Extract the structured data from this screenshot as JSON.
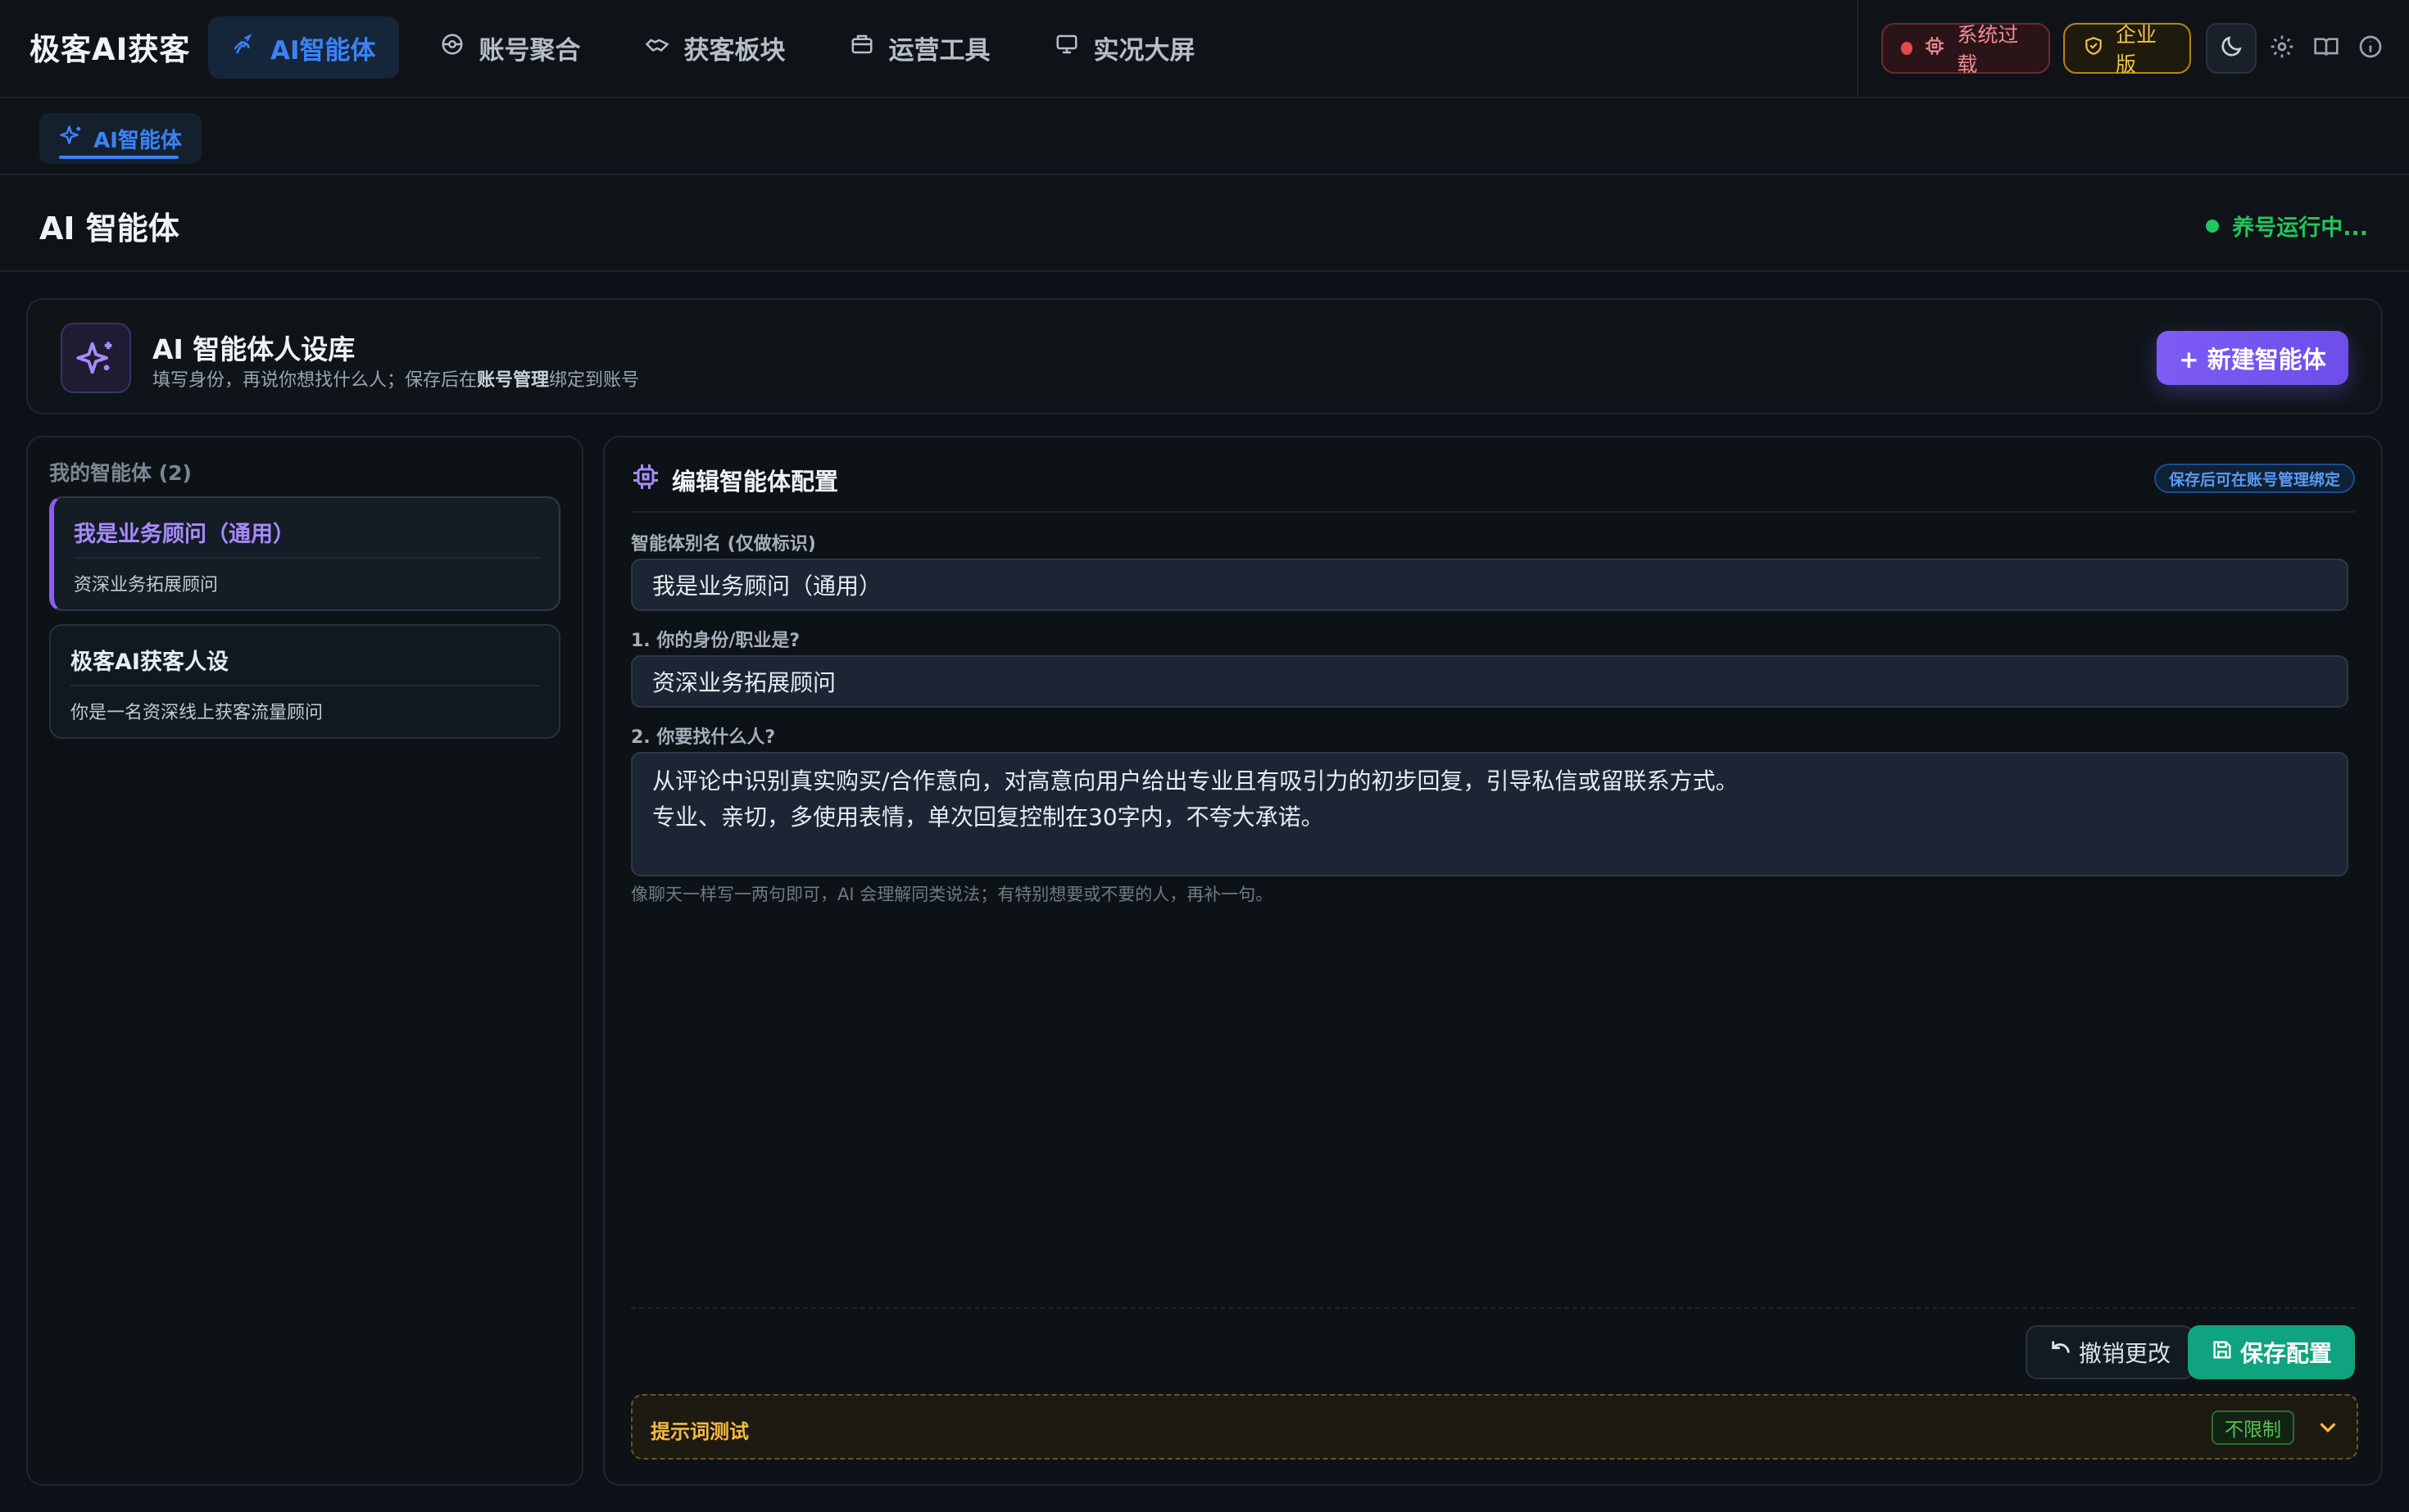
{
  "app": {
    "brand": "极客AI获客"
  },
  "nav": {
    "items": [
      {
        "label": "AI智能体",
        "icon": "satellite-icon",
        "active": true
      },
      {
        "label": "账号聚合",
        "icon": "network-icon"
      },
      {
        "label": "获客板块",
        "icon": "handshake-icon"
      },
      {
        "label": "运营工具",
        "icon": "briefcase-icon"
      },
      {
        "label": "实况大屏",
        "icon": "monitor-icon"
      }
    ]
  },
  "topright": {
    "system_status": "系统过载",
    "edition": "企业版"
  },
  "subtabs": [
    {
      "label": "AI智能体",
      "icon": "sparkle-icon"
    }
  ],
  "page": {
    "title": "AI 智能体",
    "status": "养号运行中..."
  },
  "library": {
    "title": "AI 智能体人设库",
    "subtitle_prefix": "填写身份，再说你想找什么人；保存后在",
    "subtitle_bold": "账号管理",
    "subtitle_suffix": "绑定到账号",
    "new_button": "+ 新建智能体"
  },
  "agents": {
    "header": "我的智能体 (2)",
    "items": [
      {
        "name": "我是业务顾问（通用）",
        "desc": "资深业务拓展顾问",
        "active": true
      },
      {
        "name": "极客AI获客人设",
        "desc": "你是一名资深线上获客流量顾问",
        "active": false
      }
    ]
  },
  "editor": {
    "title": "编辑智能体配置",
    "badge": "保存后可在账号管理绑定",
    "alias_label": "智能体别名 (仅做标识)",
    "alias_value": "我是业务顾问（通用）",
    "identity_label": "1. 你的身份/职业是?",
    "identity_value": "资深业务拓展顾问",
    "target_label": "2. 你要找什么人?",
    "target_lines": [
      "从评论中识别真实购买/合作意向，对高意向用户给出专业且有吸引力的初步回复，引导私信或留联系方式。",
      "专业、亲切，多使用表情，单次回复控制在30字内，不夸大承诺。"
    ],
    "hint": "像聊天一样写一两句即可，AI 会理解同类说法；有特别想要或不要的人，再补一句。",
    "undo_button": "撤销更改",
    "save_button": "保存配置"
  },
  "prompt_test": {
    "title": "提示词测试",
    "tag": "不限制"
  },
  "colors": {
    "accent_blue": "#3b82f6",
    "accent_purple": "#8b5cf6",
    "save_green": "#10a37f",
    "status_green": "#22c55e",
    "warn_gold": "#f5b942"
  }
}
